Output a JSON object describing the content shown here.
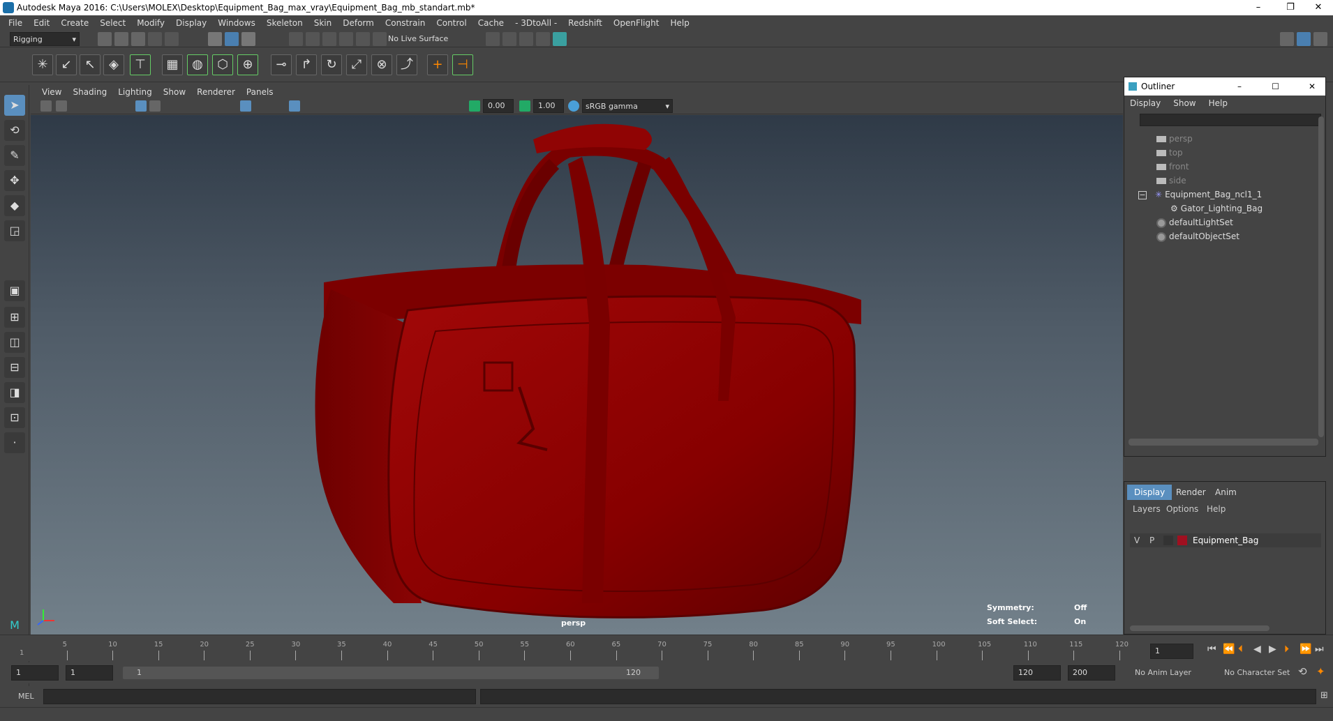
{
  "window": {
    "title": "Autodesk Maya 2016: C:\\Users\\MOLEX\\Desktop\\Equipment_Bag_max_vray\\Equipment_Bag_mb_standart.mb*"
  },
  "menu": [
    "File",
    "Edit",
    "Create",
    "Select",
    "Modify",
    "Display",
    "Windows",
    "Skeleton",
    "Skin",
    "Deform",
    "Constrain",
    "Control",
    "Cache",
    "- 3DtoAll -",
    "Redshift",
    "OpenFlight",
    "Help"
  ],
  "status": {
    "mode": "Rigging",
    "live_surface": "No Live Surface"
  },
  "panel_menu": [
    "View",
    "Shading",
    "Lighting",
    "Show",
    "Renderer",
    "Panels"
  ],
  "panel_tools": {
    "near_value": "0.00",
    "far_value": "1.00",
    "color_space": "sRGB gamma"
  },
  "viewport": {
    "camera": "persp",
    "symmetry_label": "Symmetry:",
    "symmetry_value": "Off",
    "soft_select_label": "Soft Select:",
    "soft_select_value": "On"
  },
  "outliner": {
    "title": "Outliner",
    "menu": [
      "Display",
      "Show",
      "Help"
    ],
    "items": [
      {
        "label": "persp",
        "type": "camera",
        "dim": true
      },
      {
        "label": "top",
        "type": "camera",
        "dim": true
      },
      {
        "label": "front",
        "type": "camera",
        "dim": true
      },
      {
        "label": "side",
        "type": "camera",
        "dim": true
      },
      {
        "label": "Equipment_Bag_ncl1_1",
        "type": "group"
      },
      {
        "label": "Gator_Lighting_Bag",
        "type": "mesh"
      },
      {
        "label": "defaultLightSet",
        "type": "set"
      },
      {
        "label": "defaultObjectSet",
        "type": "set"
      }
    ]
  },
  "layer_editor": {
    "tabs": [
      "Display",
      "Render",
      "Anim"
    ],
    "menu": [
      "Layers",
      "Options",
      "Help"
    ],
    "layer": {
      "v": "V",
      "p": "P",
      "name": "Equipment_Bag",
      "color": "#a01020"
    }
  },
  "timeline": {
    "ticks": [
      "5",
      "10",
      "15",
      "20",
      "25",
      "30",
      "35",
      "40",
      "45",
      "50",
      "55",
      "60",
      "65",
      "70",
      "75",
      "80",
      "85",
      "90",
      "95",
      "100",
      "105",
      "110",
      "115",
      "120"
    ],
    "current_frame": "1",
    "start_marker": "1"
  },
  "range": {
    "start": "1",
    "playback_start": "1",
    "slider_start": "1",
    "slider_end": "120",
    "playback_end": "120",
    "end": "200",
    "anim_layer": "No Anim Layer",
    "character_set": "No Character Set"
  },
  "command": {
    "mode": "MEL"
  },
  "colors": {
    "bag": "#8a0000",
    "accent": "#4a9fd8"
  }
}
